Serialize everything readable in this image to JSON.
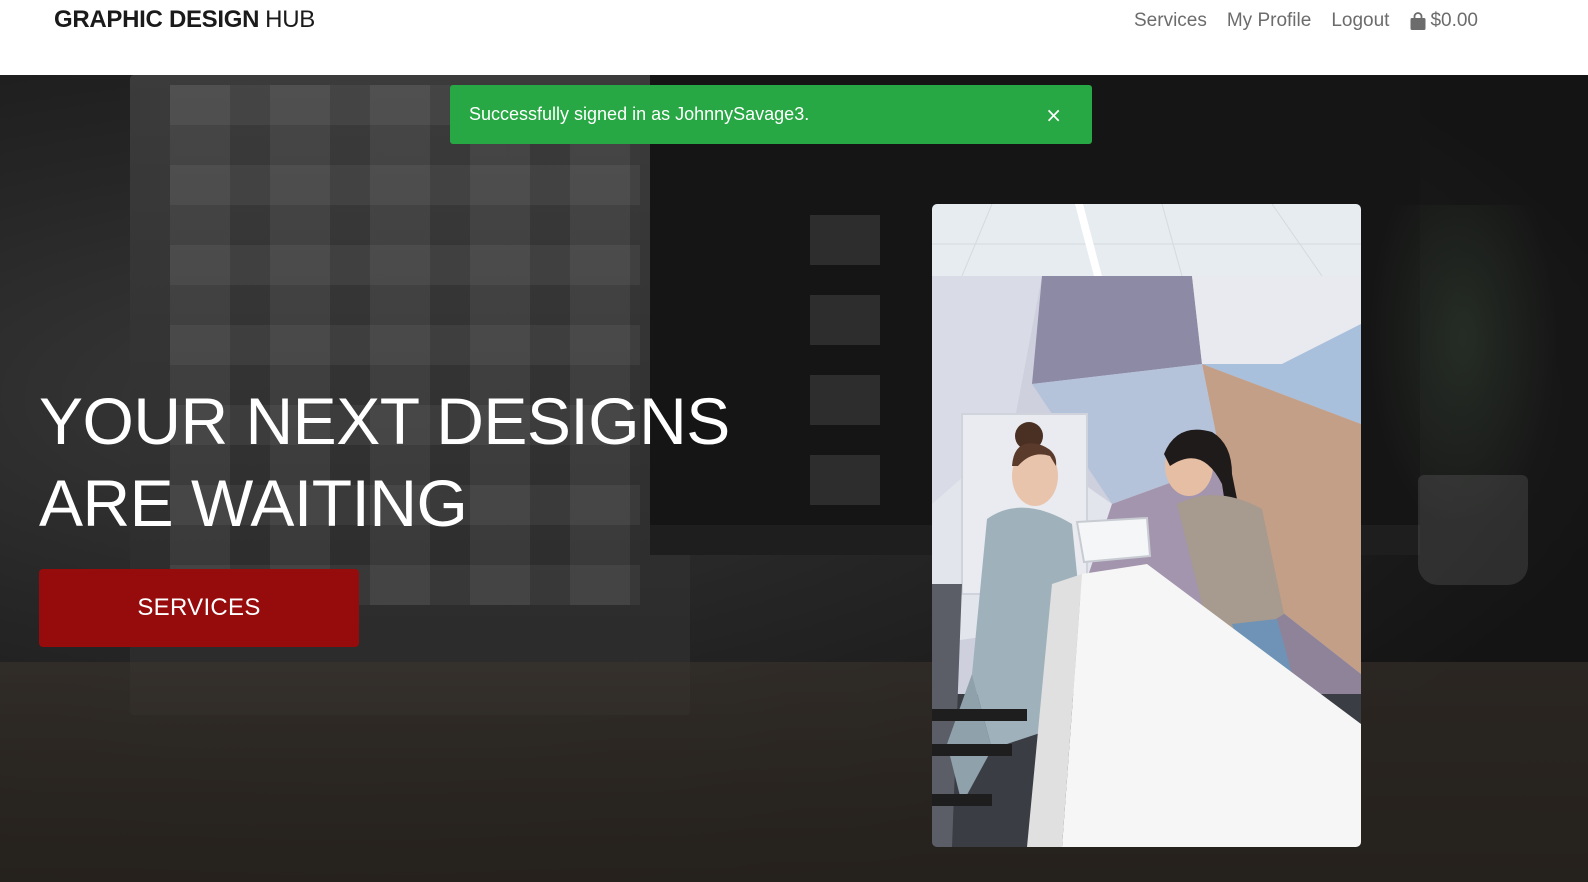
{
  "header": {
    "brand_bold": "GRAPHIC DESIGN",
    "brand_light": "HUB",
    "nav": {
      "services": "Services",
      "profile": "My Profile",
      "logout": "Logout"
    },
    "cart": {
      "icon": "shopping-bag-icon",
      "total": "$0.00"
    }
  },
  "alert": {
    "message": "Successfully signed in as JohnnySavage3.",
    "close_symbol": "×",
    "color": "#28a745"
  },
  "hero": {
    "title_line1": "YOUR NEXT DESIGNS",
    "title_line2": "ARE WAITING",
    "cta_label": "SERVICES",
    "cta_color": "#960c0c"
  }
}
